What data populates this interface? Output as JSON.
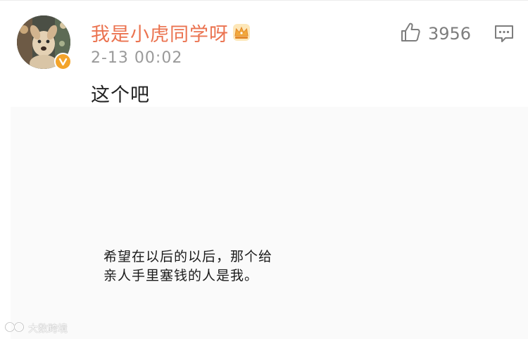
{
  "comment": {
    "username": "我是小虎同学呀",
    "timestamp": "2-13 00:02",
    "text": "这个吧",
    "likes": "3956",
    "badges": [
      "crown-icon",
      "verified-icon"
    ]
  },
  "embedded_image": {
    "caption_line1": "希望在以后的以后，那个给",
    "caption_line2": "亲人手里塞钱的人是我。"
  },
  "watermark": {
    "text": "大数跨境"
  },
  "colors": {
    "username": "#eb7350",
    "verified_badge": "#f3a42a",
    "crown": "#f2a93b",
    "icon_gray": "#7d7d7d",
    "timestamp": "#9a9a9a"
  }
}
